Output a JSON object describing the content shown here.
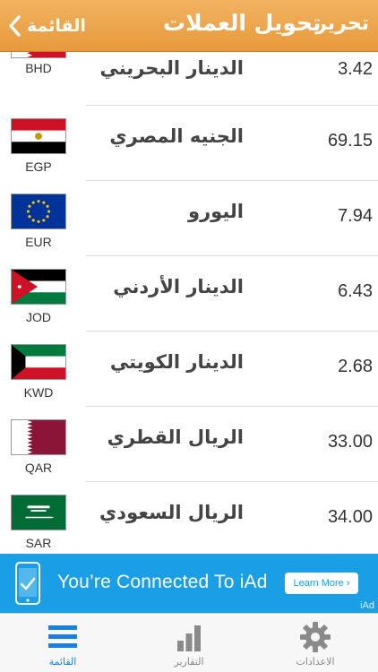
{
  "header": {
    "back_label": "القائمة",
    "title": "تحويل العملات",
    "edit_label": "تحرير"
  },
  "rows": [
    {
      "code": "BHD",
      "name": "الدينار البحريني",
      "amount": "3.42",
      "flag": "bahrain-flag"
    },
    {
      "code": "EGP",
      "name": "الجنيه المصري",
      "amount": "69.15",
      "flag": "egypt-flag"
    },
    {
      "code": "EUR",
      "name": "اليورو",
      "amount": "7.94",
      "flag": "eu-flag"
    },
    {
      "code": "JOD",
      "name": "الدينار الأردني",
      "amount": "6.43",
      "flag": "jordan-flag"
    },
    {
      "code": "KWD",
      "name": "الدينار الكويتي",
      "amount": "2.68",
      "flag": "kuwait-flag"
    },
    {
      "code": "QAR",
      "name": "الريال القطري",
      "amount": "33.00",
      "flag": "qatar-flag"
    },
    {
      "code": "SAR",
      "name": "الريال السعودي",
      "amount": "34.00",
      "flag": "saudi-flag"
    }
  ],
  "ad": {
    "text": "You’re Connected To iAd",
    "button": "Learn More ›",
    "mark": "iAd"
  },
  "tabs": [
    {
      "label": "القائمة",
      "icon": "list-icon",
      "active": true
    },
    {
      "label": "التقارير",
      "icon": "bar-chart-icon",
      "active": false
    },
    {
      "label": "الاعدادات",
      "icon": "gear-icon",
      "active": false
    }
  ],
  "colors": {
    "header": "#e89c3e",
    "active_tab": "#1a7fe0",
    "ad_background": "#1a9fe6"
  }
}
